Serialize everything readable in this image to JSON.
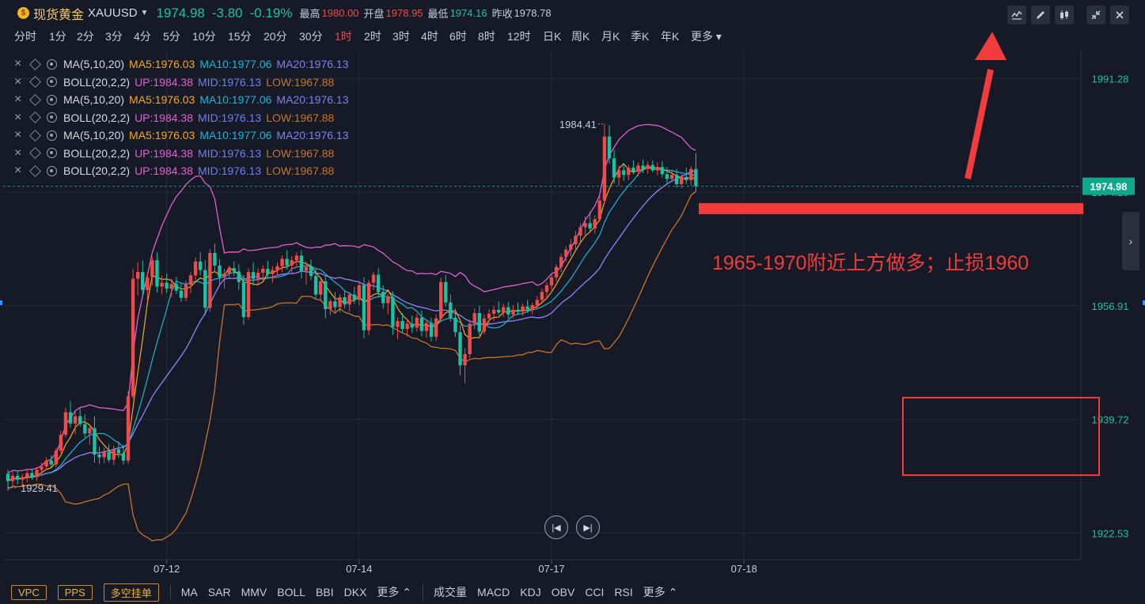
{
  "header": {
    "instrument_name": "现货黄金",
    "symbol": "XAUUSD",
    "last_price": "1974.98",
    "change": "-3.80",
    "change_pct": "-0.19%",
    "high_label": "最高",
    "high_value": "1980.00",
    "open_label": "开盘",
    "open_value": "1978.95",
    "low_label": "最低",
    "low_value": "1974.16",
    "prev_close_label": "昨收",
    "prev_close_value": "1978.78",
    "coin_icon": "gold-coin-icon"
  },
  "toolbar_icons": [
    "indicator-line-icon",
    "pencil-icon",
    "candlestick-icon",
    "collapse-icon",
    "close-icon"
  ],
  "periods": [
    "分时",
    "1分",
    "2分",
    "3分",
    "4分",
    "5分",
    "10分",
    "15分",
    "20分",
    "30分",
    "1时",
    "2时",
    "3时",
    "4时",
    "6时",
    "8时",
    "12时",
    "日K",
    "周K",
    "月K",
    "季K",
    "年K",
    "更多"
  ],
  "active_period": "1时",
  "indicators": [
    {
      "name": "MA(5,10,20)",
      "v1": "MA5:1976.03",
      "v2": "MA10:1977.06",
      "v3": "MA20:1976.13",
      "c1": "#f5a623",
      "c2": "#19b5d8",
      "c3": "#8a7cf0"
    },
    {
      "name": "BOLL(20,2,2)",
      "v1": "UP:1984.38",
      "v2": "MID:1976.13",
      "v3": "LOW:1967.88",
      "c1": "#e060d0",
      "c2": "#6f7ff0",
      "c3": "#c8742a"
    },
    {
      "name": "MA(5,10,20)",
      "v1": "MA5:1976.03",
      "v2": "MA10:1977.06",
      "v3": "MA20:1976.13",
      "c1": "#f5a623",
      "c2": "#19b5d8",
      "c3": "#8a7cf0"
    },
    {
      "name": "BOLL(20,2,2)",
      "v1": "UP:1984.38",
      "v2": "MID:1976.13",
      "v3": "LOW:1967.88",
      "c1": "#e060d0",
      "c2": "#6f7ff0",
      "c3": "#c8742a"
    },
    {
      "name": "MA(5,10,20)",
      "v1": "MA5:1976.03",
      "v2": "MA10:1977.06",
      "v3": "MA20:1976.13",
      "c1": "#f5a623",
      "c2": "#19b5d8",
      "c3": "#8a7cf0"
    },
    {
      "name": "BOLL(20,2,2)",
      "v1": "UP:1984.38",
      "v2": "MID:1976.13",
      "v3": "LOW:1967.88",
      "c1": "#e060d0",
      "c2": "#6f7ff0",
      "c3": "#c8742a"
    },
    {
      "name": "BOLL(20,2,2)",
      "v1": "UP:1984.38",
      "v2": "MID:1976.13",
      "v3": "LOW:1967.88",
      "c1": "#e060d0",
      "c2": "#6f7ff0",
      "c3": "#c8742a"
    }
  ],
  "bottom": {
    "buttons": [
      "VPC",
      "PPS",
      "多空挂单"
    ],
    "main_indicators": [
      "MA",
      "SAR",
      "MMV",
      "BOLL",
      "BBI",
      "DKX",
      "更多"
    ],
    "sub_indicators": [
      "成交量",
      "MACD",
      "KDJ",
      "OBV",
      "CCI",
      "RSI",
      "更多"
    ]
  },
  "chart_data": {
    "type": "candlestick",
    "title": "",
    "x_ticks": [
      "07-12",
      "07-14",
      "07-17",
      "07-18"
    ],
    "y_ticks": [
      1991.28,
      1974.1,
      1956.91,
      1939.72,
      1922.53
    ],
    "ylim": [
      1918.5,
      1995.5
    ],
    "current_price_tag": "1974.98",
    "current_price": 1974.98,
    "max_label": "1984.41",
    "max_value": 1984.41,
    "min_label": "1929.41",
    "min_value": 1929.41,
    "annotation_text": "1965-1970附近上方做多；止损1960",
    "support_line_value": 1971.6,
    "colors": {
      "up": "#f04a4a",
      "down": "#19c2a1",
      "ma5": "#f5a623",
      "ma10": "#19b5d8",
      "ma20": "#8a7cf0",
      "boll_up": "#e060d0",
      "boll_low": "#c8742a",
      "annotation": "#f03c3c"
    },
    "candles": [
      [
        1931.5,
        1932.1,
        1928.9,
        1930.4
      ],
      [
        1930.4,
        1931.8,
        1929.4,
        1931.2
      ],
      [
        1931.2,
        1932.0,
        1929.9,
        1930.6
      ],
      [
        1930.6,
        1931.5,
        1929.8,
        1931.0
      ],
      [
        1931.0,
        1932.0,
        1930.2,
        1931.6
      ],
      [
        1931.6,
        1932.3,
        1930.6,
        1931.0
      ],
      [
        1931.0,
        1932.5,
        1930.4,
        1932.1
      ],
      [
        1932.1,
        1933.2,
        1931.4,
        1932.6
      ],
      [
        1932.6,
        1934.0,
        1932.0,
        1933.5
      ],
      [
        1933.5,
        1934.3,
        1932.4,
        1932.9
      ],
      [
        1932.9,
        1935.4,
        1932.5,
        1935.0
      ],
      [
        1935.0,
        1938.0,
        1934.6,
        1937.4
      ],
      [
        1937.4,
        1941.5,
        1937.0,
        1940.8
      ],
      [
        1940.8,
        1942.5,
        1938.5,
        1939.1
      ],
      [
        1939.1,
        1941.0,
        1937.5,
        1940.2
      ],
      [
        1940.2,
        1941.6,
        1938.6,
        1939.0
      ],
      [
        1939.0,
        1940.5,
        1937.0,
        1937.6
      ],
      [
        1937.6,
        1939.0,
        1935.9,
        1938.4
      ],
      [
        1938.4,
        1940.2,
        1933.2,
        1934.4
      ],
      [
        1934.4,
        1935.6,
        1933.0,
        1934.0
      ],
      [
        1934.0,
        1935.5,
        1933.1,
        1934.8
      ],
      [
        1934.8,
        1936.0,
        1933.2,
        1933.6
      ],
      [
        1933.6,
        1935.8,
        1932.8,
        1935.2
      ],
      [
        1935.2,
        1936.4,
        1933.9,
        1934.6
      ],
      [
        1934.6,
        1935.9,
        1932.9,
        1933.5
      ],
      [
        1933.5,
        1944.0,
        1933.0,
        1943.2
      ],
      [
        1943.2,
        1962.5,
        1942.8,
        1961.0
      ],
      [
        1961.0,
        1963.5,
        1958.5,
        1962.0
      ],
      [
        1962.0,
        1963.8,
        1958.4,
        1959.3
      ],
      [
        1959.3,
        1962.0,
        1957.5,
        1961.2
      ],
      [
        1961.2,
        1964.3,
        1960.0,
        1963.8
      ],
      [
        1963.8,
        1965.0,
        1958.9,
        1959.8
      ],
      [
        1959.8,
        1961.5,
        1958.6,
        1960.4
      ],
      [
        1960.4,
        1961.8,
        1958.8,
        1959.5
      ],
      [
        1959.5,
        1961.0,
        1958.2,
        1960.2
      ],
      [
        1960.2,
        1961.3,
        1958.7,
        1959.2
      ],
      [
        1959.2,
        1960.3,
        1957.5,
        1958.1
      ],
      [
        1958.1,
        1960.7,
        1957.6,
        1960.1
      ],
      [
        1960.1,
        1962.0,
        1958.8,
        1961.5
      ],
      [
        1961.5,
        1964.2,
        1960.8,
        1963.6
      ],
      [
        1963.6,
        1965.0,
        1961.5,
        1962.3
      ],
      [
        1962.3,
        1963.8,
        1955.5,
        1956.6
      ],
      [
        1956.6,
        1965.5,
        1956.0,
        1964.9
      ],
      [
        1964.9,
        1966.3,
        1962.0,
        1963.0
      ],
      [
        1963.0,
        1964.0,
        1960.0,
        1961.2
      ],
      [
        1961.2,
        1962.5,
        1959.5,
        1961.8
      ],
      [
        1961.8,
        1963.0,
        1960.9,
        1962.6
      ],
      [
        1962.6,
        1963.6,
        1961.4,
        1962.1
      ],
      [
        1962.1,
        1963.2,
        1959.3,
        1960.5
      ],
      [
        1960.5,
        1961.6,
        1954.0,
        1955.2
      ],
      [
        1955.2,
        1962.6,
        1954.8,
        1962.0
      ],
      [
        1962.0,
        1963.5,
        1960.0,
        1961.0
      ],
      [
        1961.0,
        1962.6,
        1959.9,
        1961.9
      ],
      [
        1961.9,
        1963.0,
        1960.8,
        1962.5
      ],
      [
        1962.5,
        1963.7,
        1961.0,
        1961.7
      ],
      [
        1961.7,
        1962.9,
        1960.4,
        1962.3
      ],
      [
        1962.3,
        1963.5,
        1961.5,
        1962.9
      ],
      [
        1962.9,
        1964.5,
        1962.0,
        1964.0
      ],
      [
        1964.0,
        1965.3,
        1962.4,
        1963.0
      ],
      [
        1963.0,
        1964.4,
        1961.8,
        1963.8
      ],
      [
        1963.8,
        1965.0,
        1962.7,
        1964.5
      ],
      [
        1964.5,
        1965.3,
        1961.0,
        1962.2
      ],
      [
        1962.2,
        1963.6,
        1960.1,
        1962.8
      ],
      [
        1962.8,
        1963.9,
        1960.8,
        1961.4
      ],
      [
        1961.4,
        1962.5,
        1958.0,
        1958.6
      ],
      [
        1958.6,
        1961.0,
        1957.6,
        1960.6
      ],
      [
        1960.6,
        1961.4,
        1955.0,
        1956.4
      ],
      [
        1956.4,
        1958.0,
        1955.5,
        1957.6
      ],
      [
        1957.6,
        1959.0,
        1956.0,
        1956.7
      ],
      [
        1956.7,
        1958.6,
        1955.9,
        1958.2
      ],
      [
        1958.2,
        1959.2,
        1956.5,
        1957.1
      ],
      [
        1957.1,
        1959.0,
        1956.0,
        1958.6
      ],
      [
        1958.6,
        1959.8,
        1957.2,
        1957.8
      ],
      [
        1957.8,
        1960.4,
        1957.0,
        1960.0
      ],
      [
        1960.0,
        1961.2,
        1952.0,
        1953.2
      ],
      [
        1953.2,
        1960.8,
        1952.5,
        1960.4
      ],
      [
        1960.4,
        1962.0,
        1959.3,
        1961.6
      ],
      [
        1961.6,
        1962.6,
        1958.2,
        1959.0
      ],
      [
        1959.0,
        1960.0,
        1956.5,
        1957.3
      ],
      [
        1957.3,
        1958.7,
        1955.6,
        1958.2
      ],
      [
        1958.2,
        1959.1,
        1952.5,
        1953.7
      ],
      [
        1953.7,
        1955.2,
        1951.8,
        1954.6
      ],
      [
        1954.6,
        1955.8,
        1952.8,
        1953.4
      ],
      [
        1953.4,
        1954.9,
        1952.2,
        1954.2
      ],
      [
        1954.2,
        1955.4,
        1952.8,
        1953.6
      ],
      [
        1953.6,
        1955.7,
        1953.0,
        1955.1
      ],
      [
        1955.1,
        1956.2,
        1952.3,
        1953.1
      ],
      [
        1953.1,
        1954.8,
        1952.1,
        1954.3
      ],
      [
        1954.3,
        1955.1,
        1951.5,
        1952.2
      ],
      [
        1952.2,
        1955.6,
        1951.6,
        1955.0
      ],
      [
        1955.0,
        1961.2,
        1954.4,
        1960.5
      ],
      [
        1960.5,
        1961.6,
        1956.8,
        1957.4
      ],
      [
        1957.4,
        1958.6,
        1954.5,
        1955.1
      ],
      [
        1955.1,
        1956.5,
        1952.2,
        1952.9
      ],
      [
        1952.9,
        1954.0,
        1946.4,
        1947.9
      ],
      [
        1947.9,
        1950.5,
        1945.2,
        1949.6
      ],
      [
        1949.6,
        1954.8,
        1949.0,
        1954.2
      ],
      [
        1954.2,
        1956.5,
        1953.4,
        1955.8
      ],
      [
        1955.8,
        1956.9,
        1952.4,
        1953.0
      ],
      [
        1953.0,
        1955.6,
        1952.6,
        1955.0
      ],
      [
        1955.0,
        1956.4,
        1954.0,
        1955.7
      ],
      [
        1955.7,
        1956.9,
        1954.6,
        1956.3
      ],
      [
        1956.3,
        1957.6,
        1955.5,
        1955.9
      ],
      [
        1955.9,
        1957.2,
        1955.2,
        1956.7
      ],
      [
        1956.7,
        1957.5,
        1955.0,
        1955.6
      ],
      [
        1955.6,
        1957.0,
        1955.0,
        1956.3
      ],
      [
        1956.3,
        1957.4,
        1955.6,
        1956.0
      ],
      [
        1956.0,
        1957.3,
        1955.4,
        1956.8
      ],
      [
        1956.8,
        1957.8,
        1955.8,
        1956.4
      ],
      [
        1956.4,
        1957.4,
        1955.6,
        1957.0
      ],
      [
        1957.0,
        1958.4,
        1956.3,
        1957.8
      ],
      [
        1957.8,
        1959.5,
        1957.2,
        1959.0
      ],
      [
        1959.0,
        1960.5,
        1958.2,
        1960.0
      ],
      [
        1960.0,
        1961.6,
        1959.3,
        1961.2
      ],
      [
        1961.2,
        1963.2,
        1960.6,
        1962.8
      ],
      [
        1962.8,
        1964.8,
        1962.0,
        1964.3
      ],
      [
        1964.3,
        1965.9,
        1963.6,
        1965.4
      ],
      [
        1965.4,
        1967.0,
        1964.4,
        1966.2
      ],
      [
        1966.2,
        1968.2,
        1965.3,
        1967.5
      ],
      [
        1967.5,
        1969.4,
        1966.6,
        1968.8
      ],
      [
        1968.8,
        1970.4,
        1967.4,
        1969.4
      ],
      [
        1969.4,
        1971.2,
        1968.0,
        1968.6
      ],
      [
        1968.6,
        1970.6,
        1967.8,
        1970.0
      ],
      [
        1970.0,
        1973.5,
        1969.6,
        1972.8
      ],
      [
        1972.8,
        1984.4,
        1972.3,
        1982.5
      ],
      [
        1982.5,
        1984.2,
        1978.4,
        1979.2
      ],
      [
        1979.2,
        1980.5,
        1975.4,
        1976.3
      ],
      [
        1976.3,
        1978.1,
        1975.0,
        1977.4
      ],
      [
        1977.4,
        1978.5,
        1975.8,
        1976.7
      ],
      [
        1976.7,
        1978.2,
        1975.9,
        1977.8
      ],
      [
        1977.8,
        1978.9,
        1976.8,
        1977.2
      ],
      [
        1977.2,
        1978.6,
        1976.5,
        1978.1
      ],
      [
        1978.1,
        1979.0,
        1977.0,
        1977.6
      ],
      [
        1977.6,
        1978.7,
        1976.9,
        1978.2
      ],
      [
        1978.2,
        1978.9,
        1977.1,
        1977.4
      ],
      [
        1977.4,
        1978.6,
        1976.6,
        1977.9
      ],
      [
        1977.9,
        1978.8,
        1976.3,
        1976.8
      ],
      [
        1976.8,
        1977.9,
        1975.4,
        1976.1
      ],
      [
        1976.1,
        1977.4,
        1975.6,
        1976.7
      ],
      [
        1976.7,
        1977.6,
        1974.8,
        1975.3
      ],
      [
        1975.3,
        1976.9,
        1974.7,
        1976.4
      ],
      [
        1976.4,
        1977.8,
        1975.3,
        1975.9
      ],
      [
        1975.9,
        1978.0,
        1975.1,
        1977.6
      ],
      [
        1977.6,
        1980.0,
        1974.2,
        1975.0
      ]
    ]
  }
}
